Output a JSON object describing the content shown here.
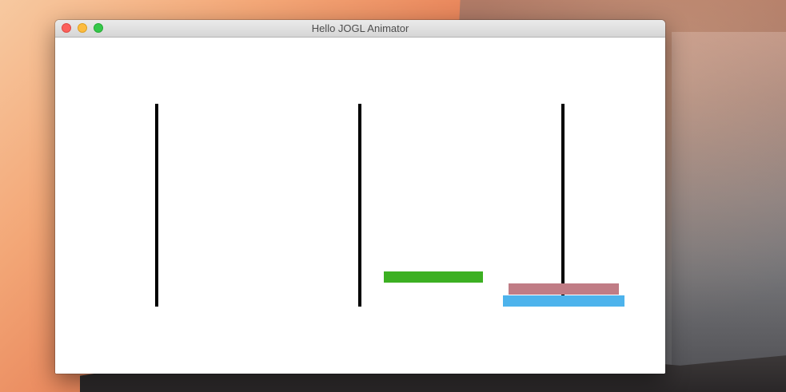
{
  "window": {
    "title": "Hello JOGL Animator"
  },
  "canvas": {
    "background": "#ffffff",
    "pegs": [
      {
        "name": "peg-left"
      },
      {
        "name": "peg-middle"
      },
      {
        "name": "peg-right"
      }
    ],
    "disks": [
      {
        "name": "green-disk",
        "color": "#3cb022"
      },
      {
        "name": "mauve-disk",
        "color": "#c07c85"
      },
      {
        "name": "blue-disk",
        "color": "#4db3ec"
      }
    ]
  }
}
